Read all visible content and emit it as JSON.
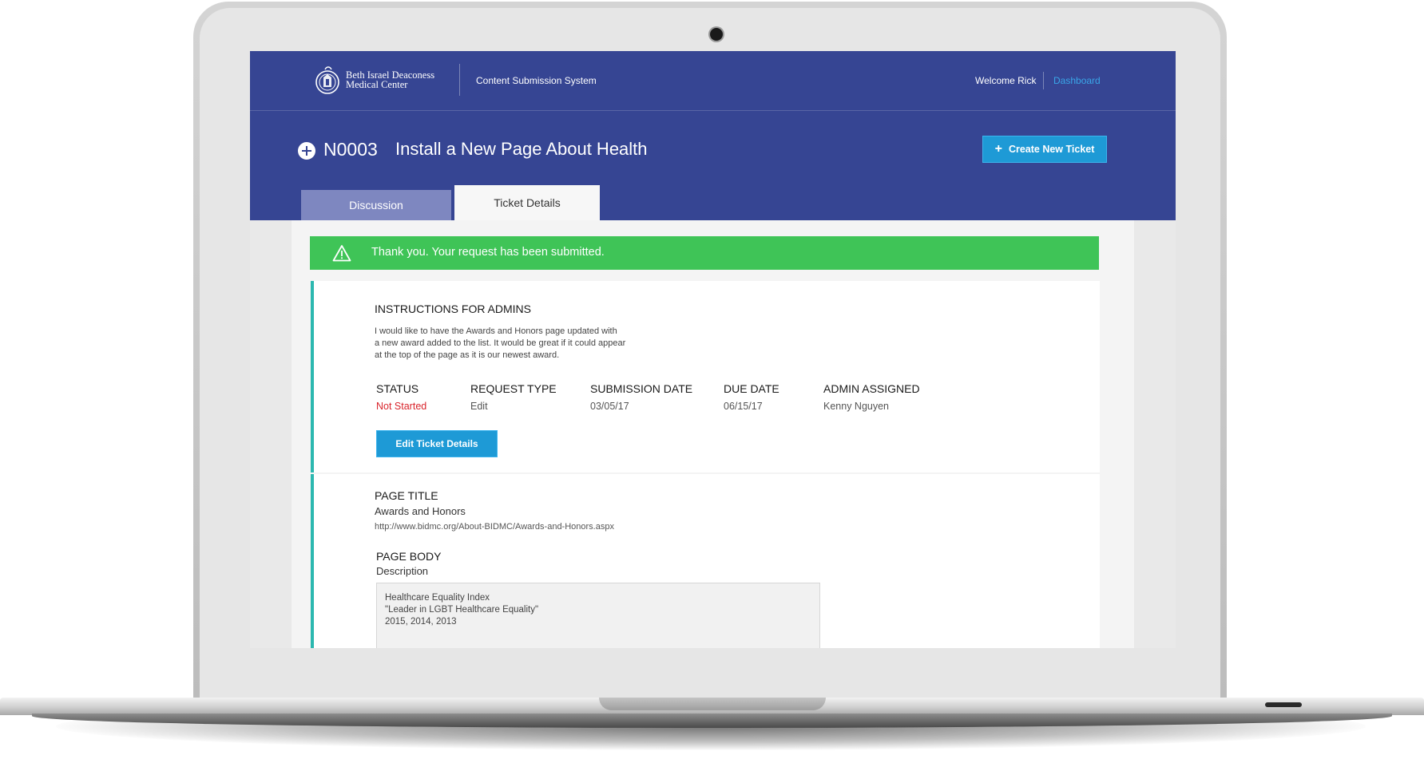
{
  "app": {
    "org_line1": "Beth Israel Deaconess",
    "org_line2": "Medical Center",
    "system_name": "Content Submission System",
    "welcome": "Welcome Rick",
    "dashboard_link": "Dashboard"
  },
  "ticket": {
    "id": "N0003",
    "title": "Install a New Page About Health",
    "create_button": "Create New Ticket"
  },
  "tabs": [
    {
      "label": "Discussion",
      "active": false
    },
    {
      "label": "Ticket Details",
      "active": true
    }
  ],
  "alert": {
    "message": "Thank you. Your request has been submitted."
  },
  "instructions": {
    "heading": "INSTRUCTIONS FOR ADMINS",
    "lines": [
      "I would like to have the Awards and Honors page updated with",
      "a new award added to the list. It would be great if it could appear",
      "at the top of the page as it is our newest award."
    ]
  },
  "details": {
    "status": {
      "label": "STATUS",
      "value": "Not Started"
    },
    "request_type": {
      "label": "REQUEST TYPE",
      "value": "Edit"
    },
    "submission_date": {
      "label": "SUBMISSION DATE",
      "value": "03/05/17"
    },
    "due_date": {
      "label": "DUE DATE",
      "value": "06/15/17"
    },
    "admin_assigned": {
      "label": "ADMIN ASSIGNED",
      "value": "Kenny Nguyen"
    },
    "edit_button": "Edit Ticket Details"
  },
  "page_title": {
    "heading": "PAGE TITLE",
    "value": "Awards and Honors",
    "url": "http://www.bidmc.org/About-BIDMC/Awards-and-Honors.aspx"
  },
  "page_body": {
    "heading": "PAGE BODY",
    "label": "Description",
    "lines": [
      "Healthcare Equality Index",
      "\"Leader in LGBT Healthcare Equality\"",
      "2015, 2014, 2013"
    ]
  },
  "colors": {
    "header": "#364593",
    "accent": "#1e9ad6",
    "success": "#3fc457",
    "status_red": "#d9242b",
    "card_border": "#2cb8b0"
  }
}
